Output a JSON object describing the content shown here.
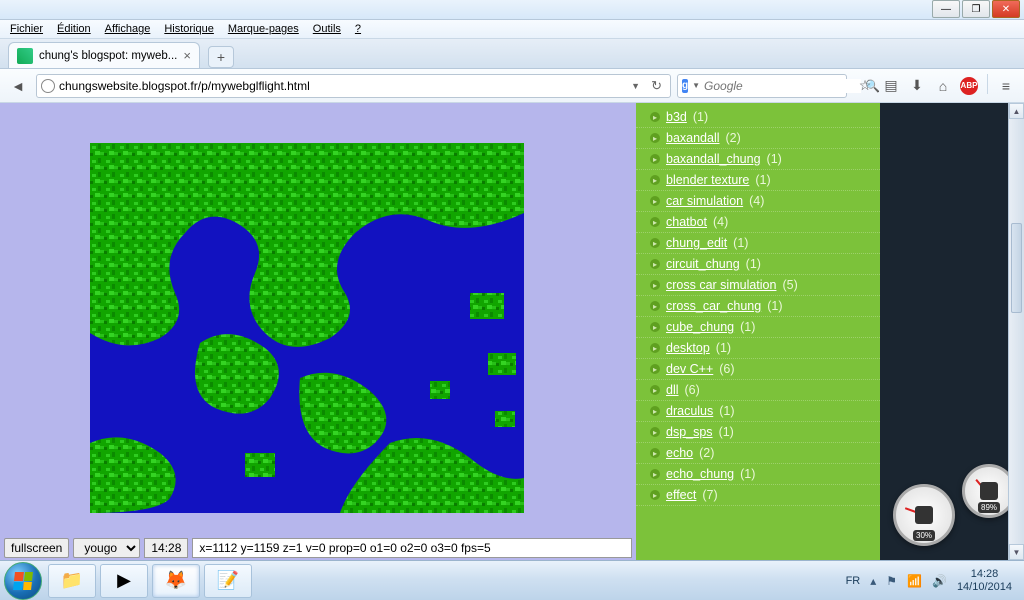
{
  "menubar": [
    "Fichier",
    "Édition",
    "Affichage",
    "Historique",
    "Marque-pages",
    "Outils",
    "?"
  ],
  "tab": {
    "title": "chung's blogspot: myweb..."
  },
  "url": "chungswebsite.blogspot.fr/p/mywebglflight.html",
  "search": {
    "placeholder": "Google"
  },
  "sidebar_tags": [
    {
      "label": "b3d",
      "count": 1
    },
    {
      "label": "baxandall",
      "count": 2
    },
    {
      "label": "baxandall_chung",
      "count": 1
    },
    {
      "label": "blender texture",
      "count": 1
    },
    {
      "label": "car simulation",
      "count": 4
    },
    {
      "label": "chatbot",
      "count": 4
    },
    {
      "label": "chung_edit",
      "count": 1
    },
    {
      "label": "circuit_chung",
      "count": 1
    },
    {
      "label": "cross car simulation",
      "count": 5
    },
    {
      "label": "cross_car_chung",
      "count": 1
    },
    {
      "label": "cube_chung",
      "count": 1
    },
    {
      "label": "desktop",
      "count": 1
    },
    {
      "label": "dev C++",
      "count": 6
    },
    {
      "label": "dll",
      "count": 6
    },
    {
      "label": "draculus",
      "count": 1
    },
    {
      "label": "dsp_sps",
      "count": 1
    },
    {
      "label": "echo",
      "count": 2
    },
    {
      "label": "echo_chung",
      "count": 1
    },
    {
      "label": "effect",
      "count": 7
    }
  ],
  "status": {
    "fullscreen_label": "fullscreen",
    "select_value": "yougo",
    "time": "14:28",
    "readout": "x=1112  y=1159  z=1  v=0  prop=0  o1=0 o2=0 o3=0 fps=5"
  },
  "gauges": {
    "big": "30%",
    "small": "89%"
  },
  "systray": {
    "lang": "FR",
    "time": "14:28",
    "date": "14/10/2014"
  },
  "win_controls": {
    "min": "—",
    "max": "❐",
    "close": "✕"
  }
}
